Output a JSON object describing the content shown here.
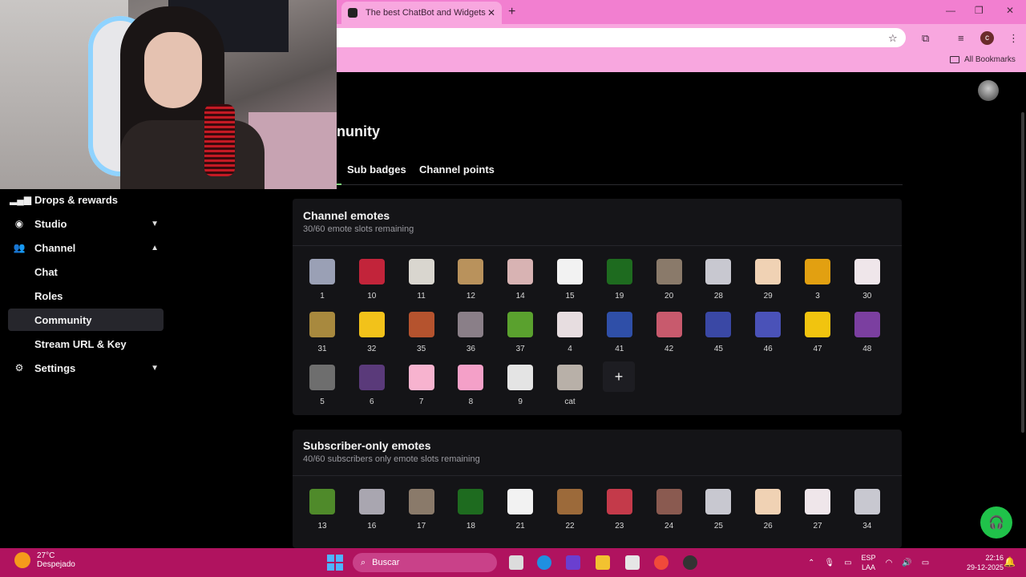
{
  "browser": {
    "tab_title": "The best ChatBot and Widgets",
    "new_tab": "+",
    "tab_close": "✕",
    "bookmarks_label": "All Bookmarks",
    "profile_initial": "c"
  },
  "sidebar": {
    "items": [
      {
        "label": "Drops & rewards",
        "icon": "bars-icon"
      },
      {
        "label": "Studio",
        "icon": "studio-icon"
      },
      {
        "label": "Channel",
        "icon": "people-icon"
      },
      {
        "label": "Settings",
        "icon": "gear-icon"
      }
    ],
    "channel_sub": [
      "Chat",
      "Roles",
      "Community",
      "Stream URL & Key"
    ],
    "active": "Community"
  },
  "header": {
    "title": "nunity",
    "tabs": [
      "Sub badges",
      "Channel points"
    ]
  },
  "channel_emotes": {
    "title": "Channel emotes",
    "subtitle": "30/60 emote slots remaining",
    "emotes": [
      {
        "label": "1",
        "color": "#9aa0b5"
      },
      {
        "label": "10",
        "color": "#c2243a"
      },
      {
        "label": "11",
        "color": "#d9d6cf"
      },
      {
        "label": "12",
        "color": "#b9925c"
      },
      {
        "label": "14",
        "color": "#d8b3b3"
      },
      {
        "label": "15",
        "color": "#f2f2f2"
      },
      {
        "label": "19",
        "color": "#1e6b1f"
      },
      {
        "label": "20",
        "color": "#8a7a6a"
      },
      {
        "label": "28",
        "color": "#c8c8d0"
      },
      {
        "label": "29",
        "color": "#f0d2b4"
      },
      {
        "label": "3",
        "color": "#e2a011"
      },
      {
        "label": "30",
        "color": "#efe6ea"
      },
      {
        "label": "31",
        "color": "#a8893e"
      },
      {
        "label": "32",
        "color": "#f2c21a"
      },
      {
        "label": "35",
        "color": "#b5532e"
      },
      {
        "label": "36",
        "color": "#8a7f88"
      },
      {
        "label": "37",
        "color": "#5aa12e"
      },
      {
        "label": "4",
        "color": "#e7dde0"
      },
      {
        "label": "41",
        "color": "#2f4fa8"
      },
      {
        "label": "42",
        "color": "#c85a6d"
      },
      {
        "label": "45",
        "color": "#3a48a5"
      },
      {
        "label": "46",
        "color": "#4a52b8"
      },
      {
        "label": "47",
        "color": "#f1c40f"
      },
      {
        "label": "48",
        "color": "#7b3fa0"
      },
      {
        "label": "5",
        "color": "#6e6e6e"
      },
      {
        "label": "6",
        "color": "#5a3a7a"
      },
      {
        "label": "7",
        "color": "#f7b3cf"
      },
      {
        "label": "8",
        "color": "#f4a0c8"
      },
      {
        "label": "9",
        "color": "#e4e4e4"
      },
      {
        "label": "cat",
        "color": "#b8b0a8"
      }
    ],
    "add_label": "+"
  },
  "subscriber_emotes": {
    "title": "Subscriber-only emotes",
    "subtitle": "40/60 subscribers only emote slots remaining",
    "emotes": [
      {
        "label": "13",
        "color": "#4f8a2a"
      },
      {
        "label": "16",
        "color": "#a9a6b0"
      },
      {
        "label": "17",
        "color": "#8a7a6a"
      },
      {
        "label": "18",
        "color": "#1e6b1f"
      },
      {
        "label": "21",
        "color": "#f2f2f2"
      },
      {
        "label": "22",
        "color": "#9c6a3a"
      },
      {
        "label": "23",
        "color": "#c43a4a"
      },
      {
        "label": "24",
        "color": "#8a5a50"
      },
      {
        "label": "25",
        "color": "#c8c8d0"
      },
      {
        "label": "26",
        "color": "#f0d2b4"
      },
      {
        "label": "27",
        "color": "#efe6ea"
      },
      {
        "label": "34",
        "color": "#c8c8d0"
      }
    ]
  },
  "taskbar": {
    "temperature": "27°C",
    "weather": "Despejado",
    "search_placeholder": "Buscar",
    "lang_top": "ESP",
    "lang_bottom": "LAA",
    "time": "22:16",
    "date": "29-12-2025"
  }
}
